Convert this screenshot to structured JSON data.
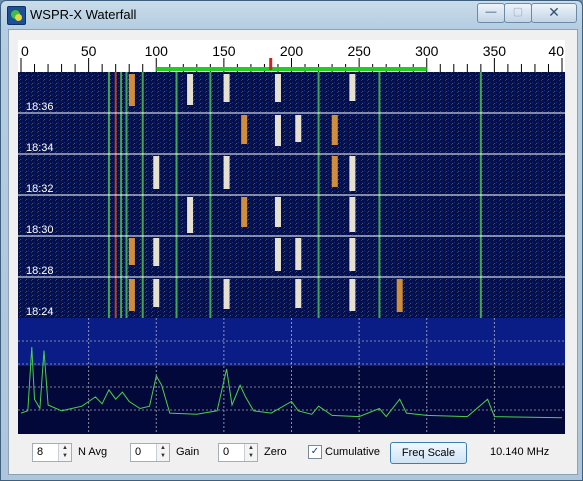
{
  "window": {
    "title": "WSPR-X Waterfall"
  },
  "titlebar_buttons": {
    "minimize": "—",
    "maximize": "▢",
    "close": "✕"
  },
  "freq_scale": {
    "ticks": [
      {
        "label": "0",
        "value": 0
      },
      {
        "label": "50",
        "value": 50
      },
      {
        "label": "100",
        "value": 100
      },
      {
        "label": "150",
        "value": 150
      },
      {
        "label": "200",
        "value": 200
      },
      {
        "label": "250",
        "value": 250
      },
      {
        "label": "300",
        "value": 300
      },
      {
        "label": "350",
        "value": 350
      },
      {
        "label": "40",
        "value": 400
      }
    ],
    "range": [
      0,
      400
    ],
    "band": [
      100,
      300
    ],
    "marker": 185,
    "band_color": "#22cc22",
    "marker_color": "#cc2222"
  },
  "waterfall": {
    "time_labels": [
      "18:36",
      "18:34",
      "18:32",
      "18:30",
      "18:28",
      "18:24"
    ],
    "signals": [
      {
        "f": 65,
        "level": "green"
      },
      {
        "f": 70,
        "level": "red"
      },
      {
        "f": 74,
        "level": "green"
      },
      {
        "f": 78,
        "level": "green"
      },
      {
        "f": 82,
        "level": "orange"
      },
      {
        "f": 90,
        "level": "green"
      },
      {
        "f": 100,
        "level": "white"
      },
      {
        "f": 115,
        "level": "green"
      },
      {
        "f": 125,
        "level": "white"
      },
      {
        "f": 140,
        "level": "green"
      },
      {
        "f": 152,
        "level": "white"
      },
      {
        "f": 165,
        "level": "orange"
      },
      {
        "f": 190,
        "level": "white"
      },
      {
        "f": 205,
        "level": "white"
      },
      {
        "f": 220,
        "level": "green"
      },
      {
        "f": 232,
        "level": "orange"
      },
      {
        "f": 245,
        "level": "white"
      },
      {
        "f": 265,
        "level": "green"
      },
      {
        "f": 280,
        "level": "orange"
      },
      {
        "f": 340,
        "level": "green"
      }
    ]
  },
  "spectrum": {
    "points": [
      {
        "f": 0,
        "v": 0.18
      },
      {
        "f": 5,
        "v": 0.2
      },
      {
        "f": 8,
        "v": 0.75
      },
      {
        "f": 10,
        "v": 0.3
      },
      {
        "f": 14,
        "v": 0.22
      },
      {
        "f": 17,
        "v": 0.72
      },
      {
        "f": 20,
        "v": 0.25
      },
      {
        "f": 30,
        "v": 0.2
      },
      {
        "f": 45,
        "v": 0.24
      },
      {
        "f": 55,
        "v": 0.32
      },
      {
        "f": 60,
        "v": 0.26
      },
      {
        "f": 65,
        "v": 0.38
      },
      {
        "f": 70,
        "v": 0.3
      },
      {
        "f": 75,
        "v": 0.36
      },
      {
        "f": 80,
        "v": 0.28
      },
      {
        "f": 88,
        "v": 0.22
      },
      {
        "f": 95,
        "v": 0.24
      },
      {
        "f": 100,
        "v": 0.5
      },
      {
        "f": 104,
        "v": 0.42
      },
      {
        "f": 110,
        "v": 0.18
      },
      {
        "f": 130,
        "v": 0.17
      },
      {
        "f": 145,
        "v": 0.2
      },
      {
        "f": 152,
        "v": 0.56
      },
      {
        "f": 156,
        "v": 0.25
      },
      {
        "f": 162,
        "v": 0.42
      },
      {
        "f": 166,
        "v": 0.32
      },
      {
        "f": 172,
        "v": 0.2
      },
      {
        "f": 185,
        "v": 0.18
      },
      {
        "f": 200,
        "v": 0.28
      },
      {
        "f": 205,
        "v": 0.2
      },
      {
        "f": 215,
        "v": 0.17
      },
      {
        "f": 220,
        "v": 0.24
      },
      {
        "f": 230,
        "v": 0.16
      },
      {
        "f": 250,
        "v": 0.15
      },
      {
        "f": 265,
        "v": 0.22
      },
      {
        "f": 270,
        "v": 0.15
      },
      {
        "f": 280,
        "v": 0.3
      },
      {
        "f": 285,
        "v": 0.18
      },
      {
        "f": 300,
        "v": 0.16
      },
      {
        "f": 330,
        "v": 0.15
      },
      {
        "f": 345,
        "v": 0.3
      },
      {
        "f": 350,
        "v": 0.15
      },
      {
        "f": 400,
        "v": 0.14
      }
    ],
    "line_color": "#4bd04b"
  },
  "controls": {
    "navg_value": "8",
    "navg_label": "N Avg",
    "gain_value": "0",
    "gain_label": "Gain",
    "zero_value": "0",
    "zero_label": "Zero",
    "cumulative_checked": "✓",
    "cumulative_label": "Cumulative",
    "freq_scale_button": "Freq Scale",
    "dial_frequency": "10.140 MHz"
  }
}
